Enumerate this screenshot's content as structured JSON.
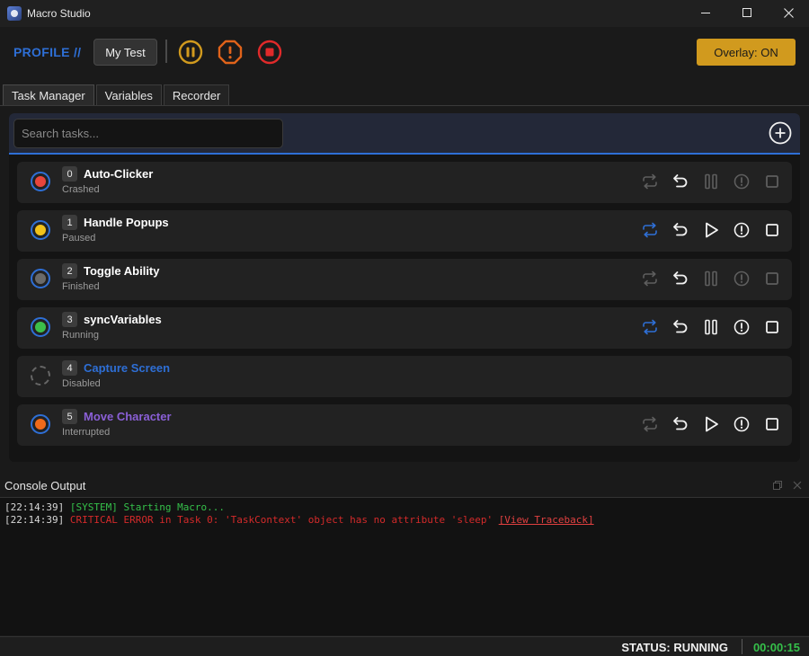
{
  "window": {
    "title": "Macro Studio",
    "icon": "app-logo-icon"
  },
  "header": {
    "profile_label": "PROFILE //",
    "profile_name": "My Test",
    "overlay_label": "Overlay: ON",
    "colors": {
      "pause": "#d19a1e",
      "alert": "#e0631a",
      "stop": "#e02a2a",
      "accent": "#2e6fd6"
    }
  },
  "tabs": [
    {
      "label": "Task Manager",
      "active": true
    },
    {
      "label": "Variables",
      "active": false
    },
    {
      "label": "Recorder",
      "active": false
    }
  ],
  "search": {
    "placeholder": "Search tasks...",
    "value": ""
  },
  "tasks": [
    {
      "index": "0",
      "name": "Auto-Clicker",
      "status": "Crashed",
      "dot_color": "#e8453c",
      "name_color": "#ffffff",
      "loop_active": false,
      "primary_action": "pause",
      "actions_enabled": false
    },
    {
      "index": "1",
      "name": "Handle Popups",
      "status": "Paused",
      "dot_color": "#f2c21a",
      "name_color": "#ffffff",
      "loop_active": true,
      "primary_action": "play",
      "actions_enabled": true
    },
    {
      "index": "2",
      "name": "Toggle Ability",
      "status": "Finished",
      "dot_color": "#6a6a6a",
      "name_color": "#ffffff",
      "loop_active": false,
      "primary_action": "pause",
      "actions_enabled": false
    },
    {
      "index": "3",
      "name": "syncVariables",
      "status": "Running",
      "dot_color": "#3cbf4a",
      "name_color": "#ffffff",
      "loop_active": true,
      "primary_action": "pause",
      "actions_enabled": true
    },
    {
      "index": "4",
      "name": "Capture Screen",
      "status": "Disabled",
      "dot_color": "",
      "name_color": "#2e6fd6",
      "loop_active": false,
      "primary_action": "",
      "actions_enabled": false
    },
    {
      "index": "5",
      "name": "Move Character",
      "status": "Interrupted",
      "dot_color": "#f06a1a",
      "name_color": "#8a5fd6",
      "loop_active": false,
      "primary_action": "play",
      "actions_enabled": true
    }
  ],
  "console": {
    "title": "Console Output",
    "lines": [
      {
        "time": "[22:14:39]",
        "message": "[SYSTEM] Starting Macro...",
        "type": "system",
        "link": ""
      },
      {
        "time": "[22:14:39]",
        "message": "CRITICAL ERROR in Task 0: 'TaskContext' object has no attribute 'sleep'",
        "type": "error",
        "link": "[View Traceback]"
      }
    ]
  },
  "status": {
    "text": "STATUS: RUNNING",
    "timer": "00:00:15"
  }
}
